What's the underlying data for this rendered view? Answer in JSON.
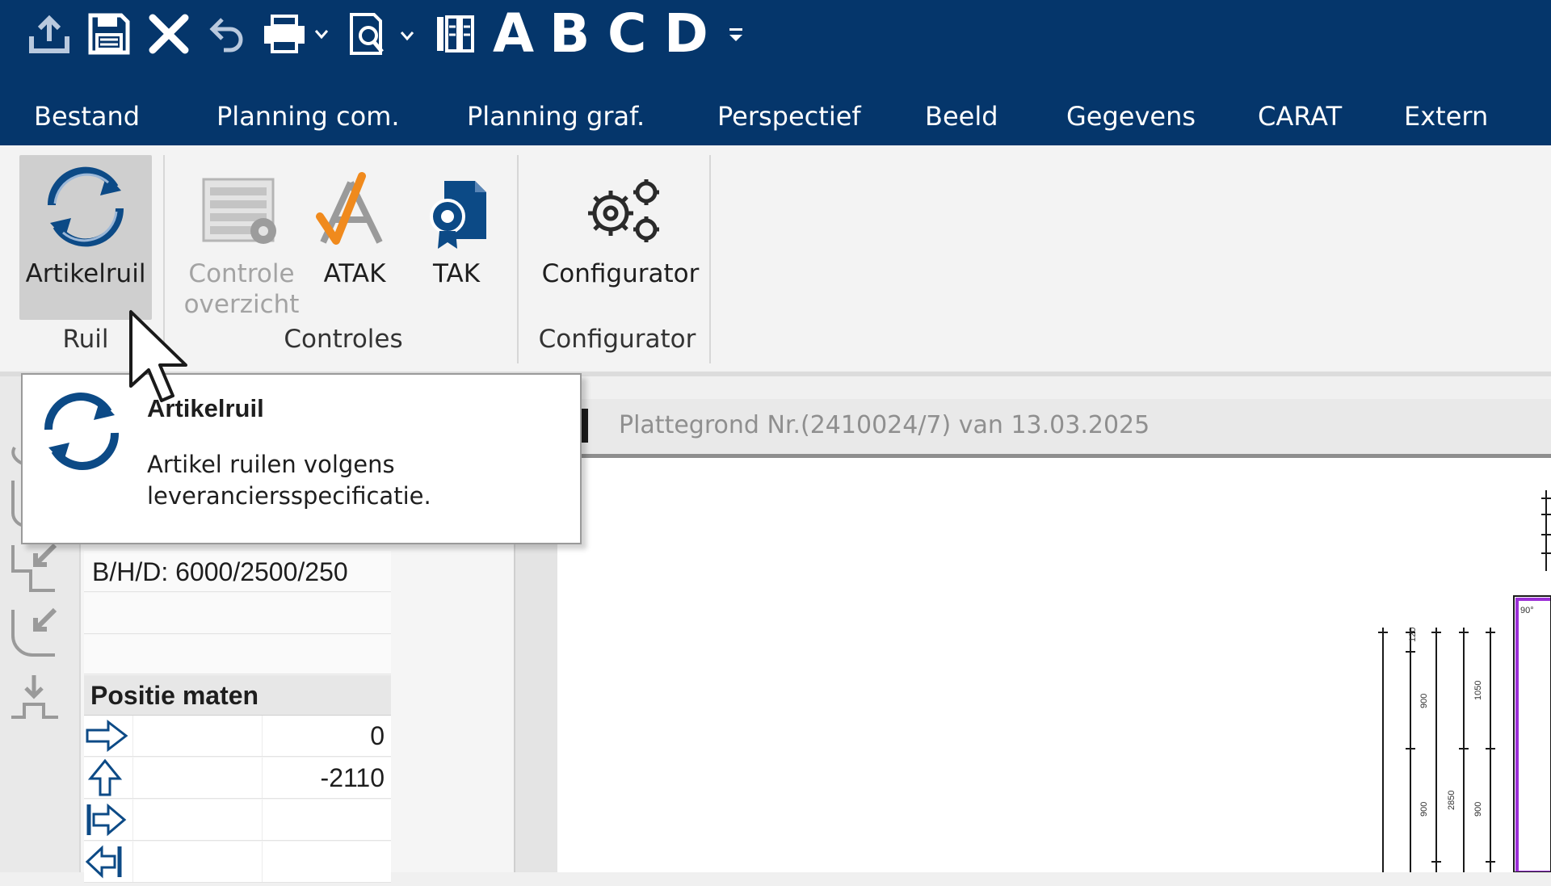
{
  "colors": {
    "titlebar_bg": "#05366b",
    "ribbon_bg": "#f3f3f3",
    "icon_blue": "#0c4a86",
    "atak_orange": "#f08a1d",
    "drawing_magenta": "#9b2fd6"
  },
  "quick_access": {
    "items": [
      {
        "name": "upload-icon"
      },
      {
        "name": "save-icon"
      },
      {
        "name": "close-icon"
      },
      {
        "name": "undo-icon"
      },
      {
        "name": "print-icon"
      },
      {
        "name": "print-preview-icon"
      },
      {
        "name": "catalog-icon"
      }
    ],
    "abcd_letters": [
      "A",
      "B",
      "C",
      "D"
    ]
  },
  "menu": {
    "items": [
      "Bestand",
      "Planning com.",
      "Planning graf.",
      "Perspectief",
      "Beeld",
      "Gegevens",
      "CARAT",
      "Extern"
    ]
  },
  "ribbon": {
    "buttons": {
      "artikelruil": "Artikelruil",
      "controle_line1": "Controle",
      "controle_line2": "overzicht",
      "atak": "ATAK",
      "tak": "TAK",
      "configurator": "Configurator"
    },
    "groups": {
      "ruil": "Ruil",
      "controles": "Controles",
      "configurator": "Configurator"
    }
  },
  "tooltip": {
    "title": "Artikelruil",
    "description": "Artikel ruilen volgens leveranciersspecificatie."
  },
  "properties": {
    "dimensions": "B/H/D: 6000/2500/250",
    "section_title": "Positie maten",
    "positions": [
      {
        "icon": "arrow-right-icon",
        "value": "0"
      },
      {
        "icon": "arrow-up-icon",
        "value": "-2110"
      },
      {
        "icon": "arrow-right-bar-icon",
        "value": ""
      },
      {
        "icon": "arrow-left-bar-icon",
        "value": ""
      }
    ]
  },
  "document": {
    "title": "Plattegrond Nr.(2410024/7) van 13.03.2025"
  },
  "drawing": {
    "dimension_labels": [
      "120",
      "900",
      "1050",
      "900",
      "2850",
      "900",
      "90°"
    ]
  }
}
